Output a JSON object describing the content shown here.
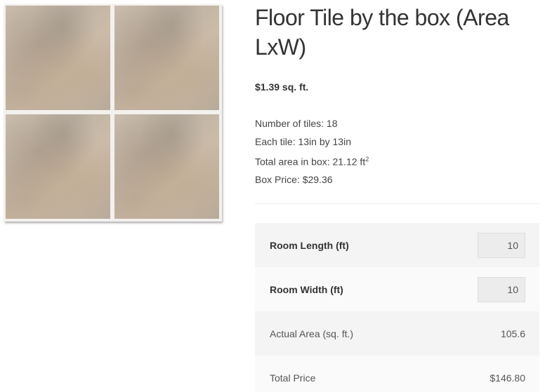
{
  "product": {
    "title": "Floor Tile by the box (Area LxW)",
    "price": "$1.39 sq. ft.",
    "image_icon": "floor-tile-photo"
  },
  "specs": {
    "number_of_tiles": "Number of tiles: 18",
    "tile_size": "Each tile: 13in by 13in",
    "total_area_prefix": "Total area in box: 21.12 ft",
    "total_area_exponent": "2",
    "box_price": "Box Price: $29.36"
  },
  "calculator": {
    "room_length_label": "Room Length (ft)",
    "room_length_value": "10",
    "room_width_label": "Room Width (ft)",
    "room_width_value": "10",
    "actual_area_label": "Actual Area (sq. ft.)",
    "actual_area_value": "105.6",
    "total_price_label": "Total Price",
    "total_price_value": "$146.80"
  }
}
